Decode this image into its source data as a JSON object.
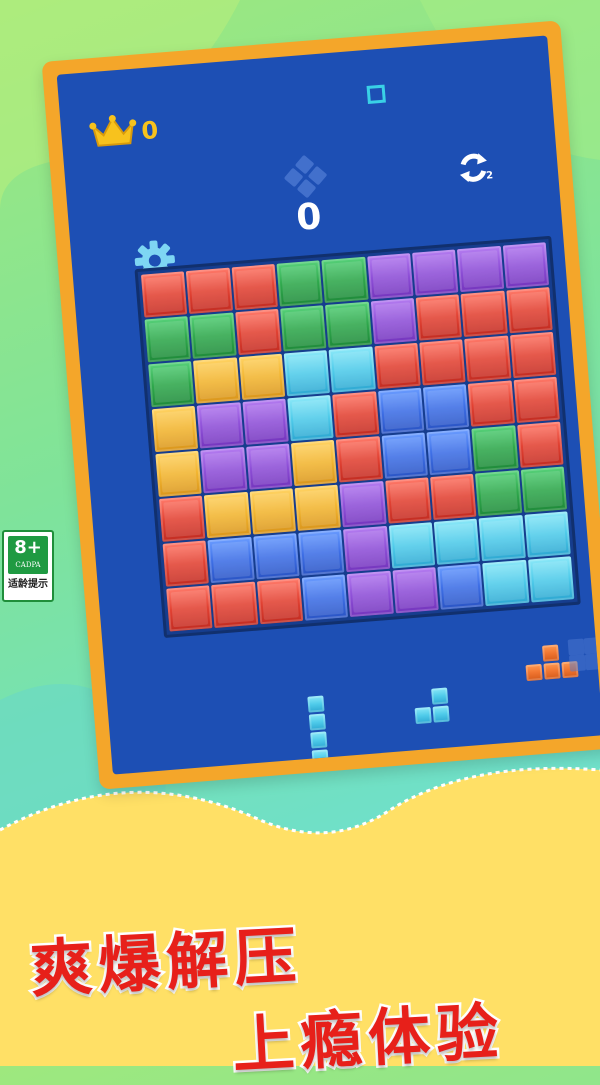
{
  "hud": {
    "best_score": "0",
    "score": "0",
    "refresh_count": "2"
  },
  "icons": {
    "crown": "crown-icon",
    "mode": "square-mode-icon",
    "settings": "gear-icon",
    "refresh": "refresh-icon"
  },
  "board": {
    "rows": 8,
    "cols": 9,
    "grid": [
      [
        "r",
        "r",
        "r",
        "g",
        "g",
        "p",
        "p",
        "p",
        "p"
      ],
      [
        "g",
        "g",
        "r",
        "g",
        "g",
        "p",
        "r",
        "r",
        "r"
      ],
      [
        "g",
        "y",
        "y",
        "c",
        "c",
        "r",
        "r",
        "r",
        "r"
      ],
      [
        "y",
        "p",
        "p",
        "c",
        "r",
        "b",
        "b",
        "r",
        "r"
      ],
      [
        "y",
        "p",
        "p",
        "y",
        "r",
        "b",
        "b",
        "g",
        "r"
      ],
      [
        "r",
        "y",
        "y",
        "y",
        "p",
        "r",
        "r",
        "g",
        "g"
      ],
      [
        "r",
        "b",
        "b",
        "b",
        "p",
        "c",
        "c",
        "c",
        "c"
      ],
      [
        "r",
        "r",
        "r",
        "b",
        "p",
        "p",
        "b",
        "c",
        "c"
      ]
    ]
  },
  "colors": {
    "r": "#e24233",
    "g": "#2fa84c",
    "p": "#8f50d8",
    "y": "#f2b530",
    "c": "#4fcbea",
    "b": "#3e6fe6",
    "o": "#f07530",
    "frame": "#f4a62a",
    "screen": "#1d4fb4"
  },
  "pieces": [
    {
      "name": "vertical-i-piece",
      "color": "c"
    },
    {
      "name": "s-piece",
      "color": "c"
    },
    {
      "name": "l-piece",
      "color": "o"
    }
  ],
  "age_badge": {
    "rating": "8+",
    "org": "CADPA",
    "hint": "适龄提示"
  },
  "slogan": {
    "line1": "爽爆解压",
    "line2": "上瘾体验"
  }
}
